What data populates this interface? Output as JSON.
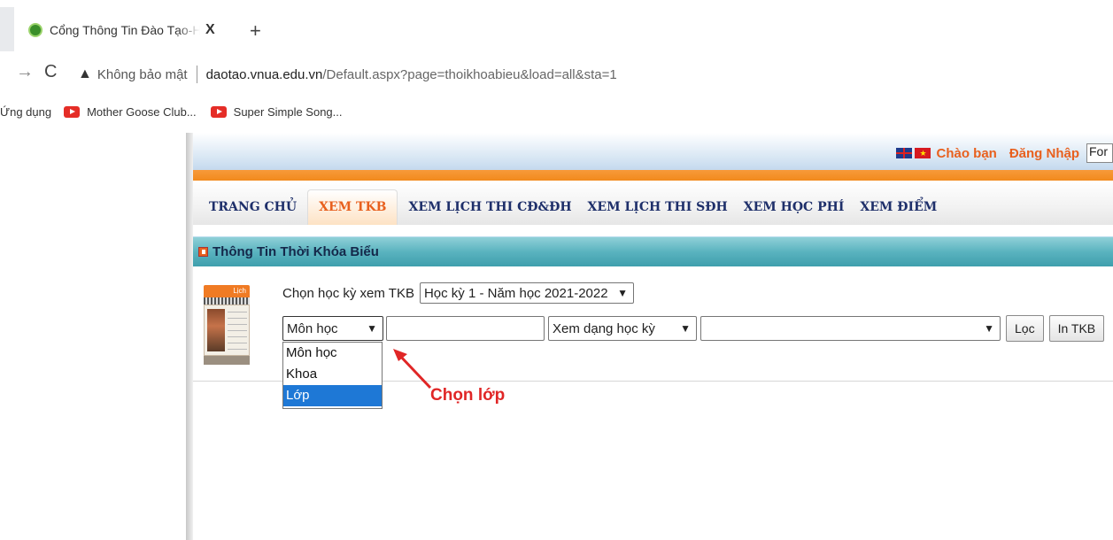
{
  "browser": {
    "tab_title": "Cổng Thông Tin Đào Tạo-Học viện Nông nghiệp Việt Nam",
    "close_glyph": "X",
    "newtab_glyph": "+",
    "security_label": "Không bảo mật",
    "url_host": "daotao.vnua.edu.vn",
    "url_path": "/Default.aspx?page=thoikhoabieu&load=all&sta=1",
    "bookmarks": {
      "apps": "Ứng dụng",
      "items": [
        "Mother Goose Club...",
        "Super Simple Song..."
      ]
    }
  },
  "header": {
    "greeting": "Chào bạn",
    "login": "Đăng Nhập",
    "input_value": "For"
  },
  "menu": {
    "items": [
      "TRANG CHỦ",
      "XEM TKB",
      "XEM LỊCH THI CĐ&ĐH",
      "XEM LỊCH THI SĐH",
      "XEM HỌC PHÍ",
      "XEM ĐIỂM"
    ],
    "active_index": 1
  },
  "section": {
    "title": "Thông Tin Thời Khóa Biểu"
  },
  "calendar_label": "Lịch",
  "form": {
    "term_label": "Chọn học kỳ xem TKB",
    "term_value": "Học kỳ 1 - Năm học 2021-2022",
    "subject_value": "Môn học",
    "view_value": "Xem dạng học kỳ",
    "wide_value": "",
    "filter_button": "Lọc",
    "print_button": "In TKB",
    "dropdown_options": [
      "Môn học",
      "Khoa",
      "Lớp"
    ],
    "dropdown_selected_index": 2
  },
  "annotation": {
    "text": "Chọn lớp",
    "color": "#e02626"
  },
  "colors": {
    "accent_orange": "#f28a1c",
    "menu_text": "#1e2f6a",
    "section_bar": "#5ab3bf",
    "selection_blue": "#1e78d6"
  }
}
